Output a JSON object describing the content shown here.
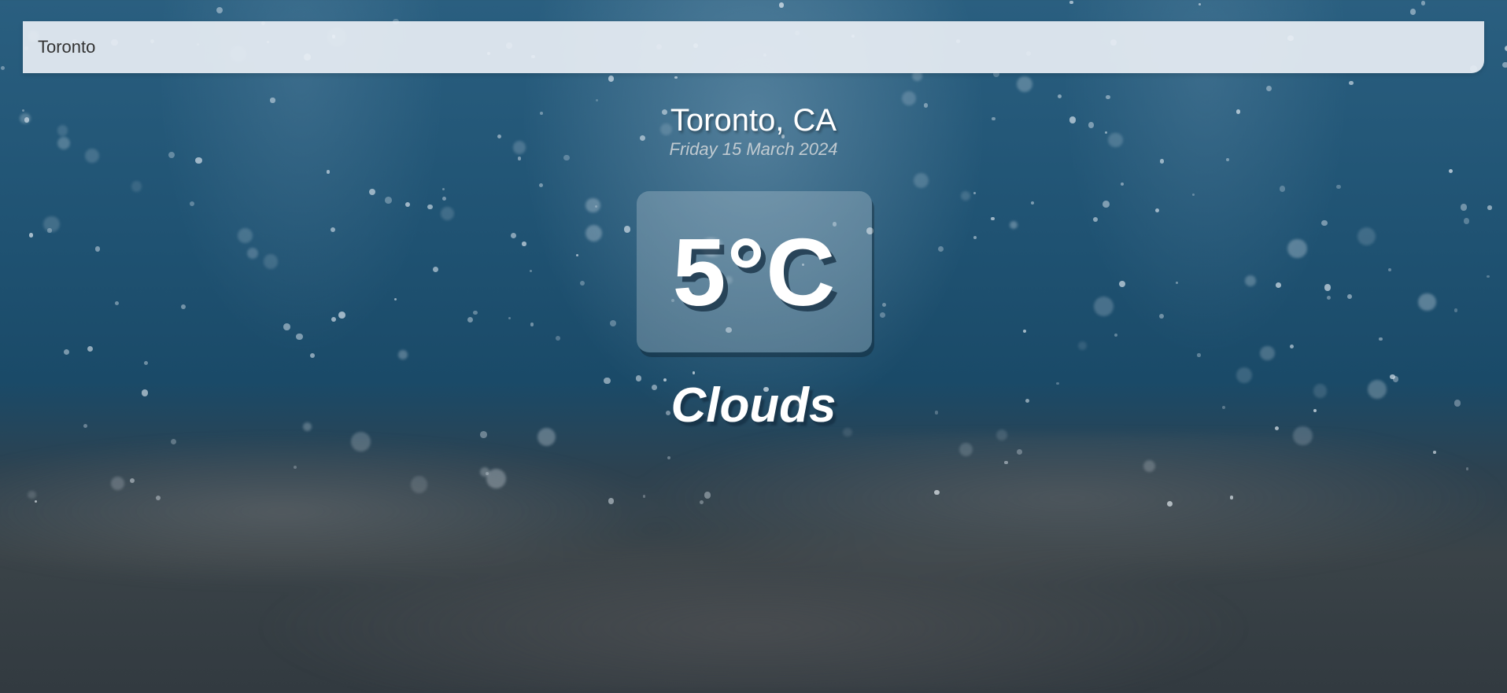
{
  "search": {
    "value": "Toronto",
    "placeholder": ""
  },
  "location": {
    "city": "Toronto, CA",
    "date": "Friday 15 March 2024"
  },
  "weather": {
    "temperature": "5°C",
    "condition": "Clouds"
  },
  "icons": {
    "background": "snow-scene"
  }
}
